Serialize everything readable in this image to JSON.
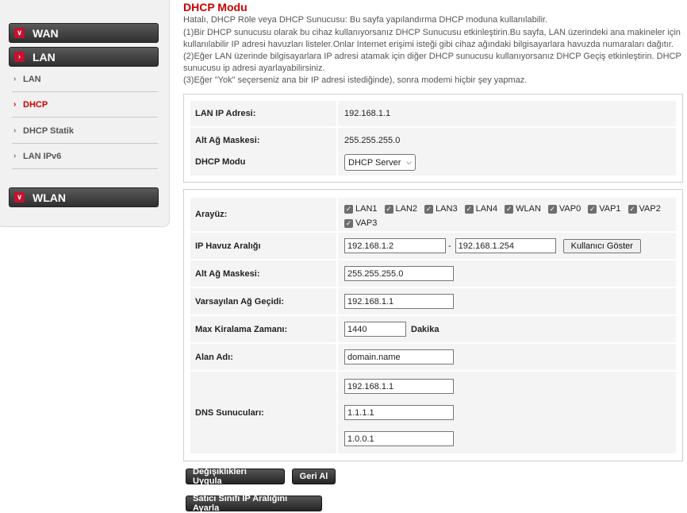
{
  "sidebar": {
    "wan_label": "WAN",
    "lan_label": "LAN",
    "wlan_label": "WLAN",
    "items": [
      {
        "label": "LAN"
      },
      {
        "label": "DHCP"
      },
      {
        "label": "DHCP Statik"
      },
      {
        "label": "LAN IPv6"
      }
    ],
    "active_item": "DHCP"
  },
  "main": {
    "title": "DHCP Modu",
    "description": [
      "Hatalı, DHCP Röle veya DHCP Sunucusu: Bu sayfa yapılandırma DHCP moduna kullanılabilir.",
      "(1)Bir DHCP sunucusu olarak bu cihaz kullanıyorsanız DHCP Sunucusu etkinleştirin.Bu sayfa, LAN üzerindeki ana makineler için",
      "kullanılabilir IP adresi havuzları listeler.Onlar Internet erişimi isteği gibi cihaz ağındaki bilgisayarlara havuzda numaraları dağıtır.",
      "(2)Eğer LAN üzerinde bilgisayarlara IP adresi atamak için diğer DHCP sunucusu kullanıyorsanız DHCP Geçiş etkinleştirin. DHCP",
      "sunucusu ip adresi ayarlayabilirsiniz.",
      "(3)Eğer \"Yok\" seçerseniz ana bir IP adresi istediğinde), sonra modemi hiçbir şey yapmaz."
    ]
  },
  "lan_info": {
    "ip_label": "LAN IP Adresi:",
    "ip_value": "192.168.1.1",
    "mask_label": "Alt Ağ Maskesi:",
    "mask_value": "255.255.255.0",
    "mode_label": "DHCP Modu",
    "mode_selected": "DHCP Server"
  },
  "dhcp": {
    "interface_label": "Arayüz:",
    "interfaces": [
      "LAN1",
      "LAN2",
      "LAN3",
      "LAN4",
      "WLAN",
      "VAP0",
      "VAP1",
      "VAP2",
      "VAP3"
    ],
    "pool_label": "IP Havuz Aralığı",
    "pool_start": "192.168.1.2",
    "pool_sep": "-",
    "pool_end": "192.168.1.254",
    "show_users_button": "Kullanıcı Göster",
    "mask_label": "Alt Ağ Maskesi:",
    "mask_value": "255.255.255.0",
    "gateway_label": "Varsayılan Ağ Geçidi:",
    "gateway_value": "192.168.1.1",
    "lease_label": "Max Kiralama Zamanı:",
    "lease_value": "1440",
    "lease_unit": "Dakika",
    "domain_label": "Alan Adı:",
    "domain_value": "domain.name",
    "dns_label": "DNS Sunucuları:",
    "dns_values": [
      "192.168.1.1",
      "1.1.1.1",
      "1.0.0.1"
    ]
  },
  "actions": {
    "apply": "Değişiklikleri Uygula",
    "undo": "Geri Al",
    "vendor": "Satıcı Sınıfı IP Aralığını Ayarla"
  },
  "colors": {
    "accent": "#cc0000",
    "menu_dark": "#2f2f2f"
  }
}
